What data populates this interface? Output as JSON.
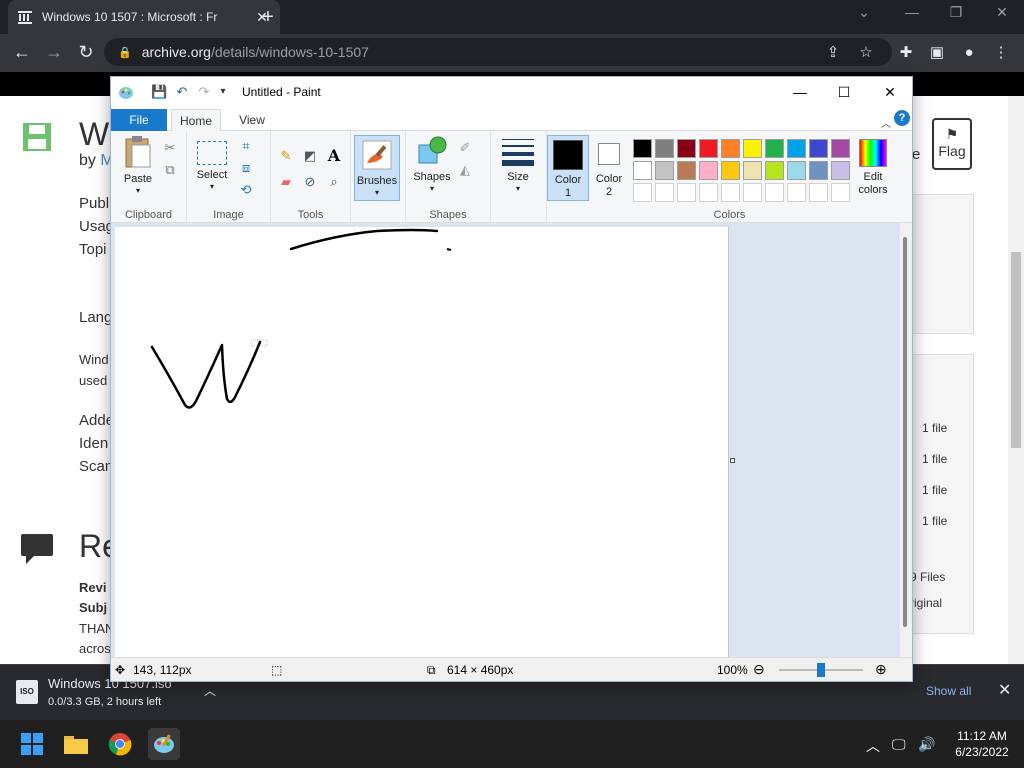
{
  "browser": {
    "tab_title": "Windows 10 1507 : Microsoft : Fr",
    "url_domain": "archive.org",
    "url_path": "/details/windows-10-1507",
    "new_tab": "+",
    "close_tab": "✕"
  },
  "webpage": {
    "title_partial": "Wi",
    "by_label": "by",
    "by_link": "M",
    "field1": "Publ",
    "field2": "Usag",
    "field3": "Topi",
    "field4": "Lang",
    "desc1": "Wind",
    "desc2": "used",
    "meta1": "Adde",
    "meta2": "Iden",
    "meta3": "Scan",
    "reviews_title": "Re",
    "review_label": "Revi",
    "subject_label": "Subj",
    "review_text1": "THAN",
    "review_text2": "acros",
    "flag_label": "Flag",
    "partial_e": "e",
    "file_counts": [
      "1 file",
      "1 file",
      "1 file",
      "1 file"
    ],
    "files_total": "9 Files",
    "original": "riginal"
  },
  "download": {
    "filename": "Windows 10 1507.iso",
    "status": "0.0/3.3 GB, 2 hours left",
    "icon_text": "ISO",
    "show_all": "Show all"
  },
  "taskbar": {
    "time": "11:12 AM",
    "date": "6/23/2022"
  },
  "paint": {
    "window_title": "Untitled - Paint",
    "tabs": {
      "file": "File",
      "home": "Home",
      "view": "View"
    },
    "groups": {
      "clipboard": "Clipboard",
      "image": "Image",
      "tools": "Tools",
      "shapes": "Shapes",
      "colors": "Colors"
    },
    "buttons": {
      "paste": "Paste",
      "select": "Select",
      "brushes": "Brushes",
      "shapes": "Shapes",
      "size": "Size",
      "color1_line1": "Color",
      "color1_line2": "1",
      "color2_line1": "Color",
      "color2_line2": "2",
      "edit_colors_line1": "Edit",
      "edit_colors_line2": "colors"
    },
    "palette_row1": [
      "#000000",
      "#7f7f7f",
      "#880015",
      "#ed1c24",
      "#ff7f27",
      "#fff200",
      "#22b14c",
      "#00a2e8",
      "#3f48cc",
      "#a349a4"
    ],
    "palette_row2": [
      "#ffffff",
      "#c3c3c3",
      "#b97a57",
      "#ffaec9",
      "#ffc90e",
      "#efe4b0",
      "#b5e61d",
      "#99d9ea",
      "#7092be",
      "#c8bfe7"
    ],
    "color1": "#000000",
    "color2": "#ffffff",
    "status": {
      "cursor_pos": "143, 112px",
      "canvas_size": "614 × 460px",
      "zoom": "100%"
    }
  }
}
